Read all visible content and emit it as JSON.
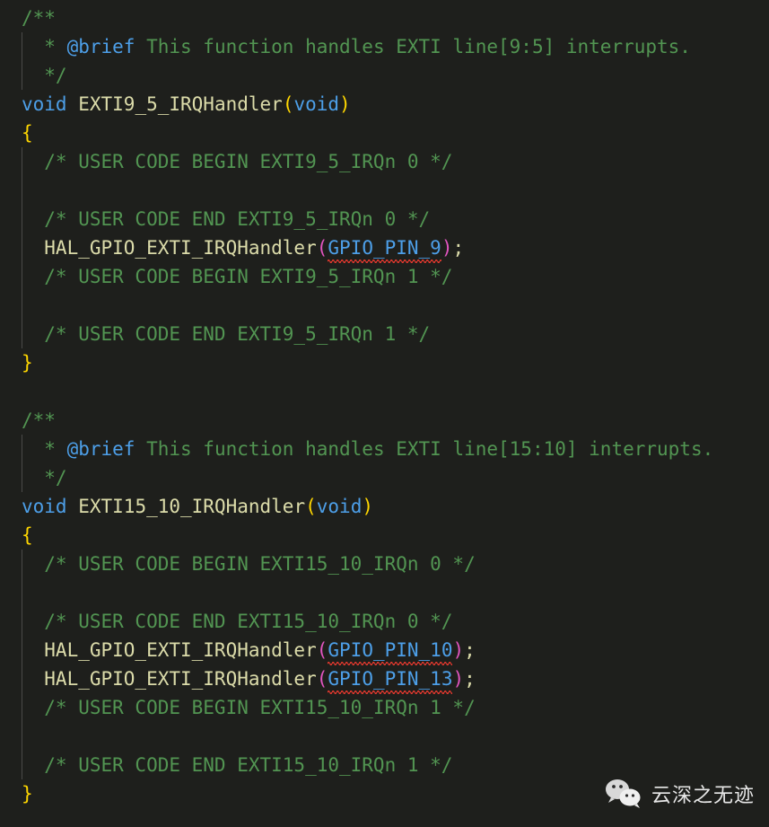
{
  "editor": {
    "background_color": "#1e1f1c",
    "language": "C",
    "font_size_px": 21,
    "line_height_px": 32
  },
  "colors": {
    "comment": "#529552",
    "keyword": "#4d9fe8",
    "doc_tag": "#4d9fe8",
    "function_name": "#dcdcaa",
    "brace": "#ffd700",
    "paren_declaration": "#ffd700",
    "paren_call": "#e255c0",
    "macro_argument": "#4d9fe8",
    "error_squiggle": "#e8392e",
    "indent_guide": "#4a4a48",
    "default_text": "#d4d4d4"
  },
  "code": {
    "line01": {
      "comment_open": "/**"
    },
    "line02": {
      "star": "  * ",
      "tag": "@brief",
      "text": " This function handles EXTI line[9:5] interrupts."
    },
    "line03": {
      "comment_close": "  */"
    },
    "line04": {
      "kw_void": "void",
      "space": " ",
      "func": "EXTI9_5_IRQHandler",
      "paren_open": "(",
      "kw_param": "void",
      "paren_close": ")"
    },
    "line05": {
      "brace": "{"
    },
    "line06": {
      "comment": "  /* USER CODE BEGIN EXTI9_5_IRQn 0 */"
    },
    "line07": {
      "blank": ""
    },
    "line08": {
      "comment": "  /* USER CODE END EXTI9_5_IRQn 0 */"
    },
    "line09": {
      "func": "  HAL_GPIO_EXTI_IRQHandler",
      "paren_open": "(",
      "macro": "GPIO_PIN_9",
      "paren_close": ")",
      "semi": ";"
    },
    "line10": {
      "comment": "  /* USER CODE BEGIN EXTI9_5_IRQn 1 */"
    },
    "line11": {
      "blank": ""
    },
    "line12": {
      "comment": "  /* USER CODE END EXTI9_5_IRQn 1 */"
    },
    "line13": {
      "brace": "}"
    },
    "line14": {
      "blank": ""
    },
    "line15": {
      "comment_open": "/**"
    },
    "line16": {
      "star": "  * ",
      "tag": "@brief",
      "text": " This function handles EXTI line[15:10] interrupts."
    },
    "line17": {
      "comment_close": "  */"
    },
    "line18": {
      "kw_void": "void",
      "space": " ",
      "func": "EXTI15_10_IRQHandler",
      "paren_open": "(",
      "kw_param": "void",
      "paren_close": ")"
    },
    "line19": {
      "brace": "{"
    },
    "line20": {
      "comment": "  /* USER CODE BEGIN EXTI15_10_IRQn 0 */"
    },
    "line21": {
      "blank": ""
    },
    "line22": {
      "comment": "  /* USER CODE END EXTI15_10_IRQn 0 */"
    },
    "line23": {
      "func": "  HAL_GPIO_EXTI_IRQHandler",
      "paren_open": "(",
      "macro": "GPIO_PIN_10",
      "paren_close": ")",
      "semi": ";"
    },
    "line24": {
      "func": "  HAL_GPIO_EXTI_IRQHandler",
      "paren_open": "(",
      "macro": "GPIO_PIN_13",
      "paren_close": ")",
      "semi": ";"
    },
    "line25": {
      "comment": "  /* USER CODE BEGIN EXTI15_10_IRQn 1 */"
    },
    "line26": {
      "blank": ""
    },
    "line27": {
      "comment": "  /* USER CODE END EXTI15_10_IRQn 1 */"
    },
    "line28": {
      "brace": "}"
    }
  },
  "watermark": {
    "icon": "wechat-icon",
    "text": "云深之无迹"
  }
}
